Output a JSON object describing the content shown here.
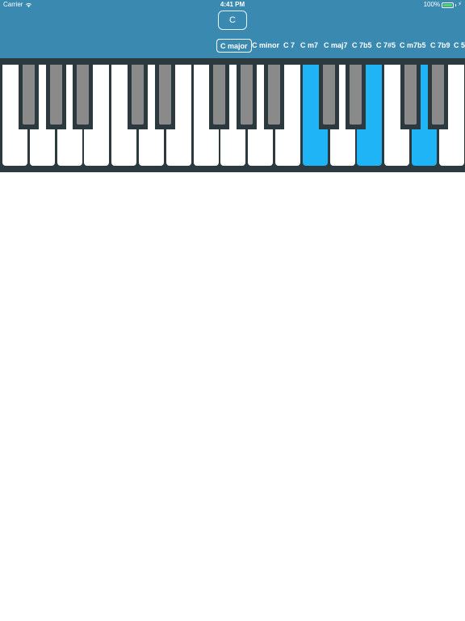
{
  "status_bar": {
    "carrier": "Carrier",
    "time": "4:41 PM",
    "battery": "100%",
    "icons": [
      "wifi-icon",
      "battery-icon",
      "charging-bolt-icon"
    ]
  },
  "key_selector": {
    "label": "C"
  },
  "chords": [
    {
      "label": "C major",
      "selected": true
    },
    {
      "label": "C minor",
      "selected": false
    },
    {
      "label": "C 7",
      "selected": false
    },
    {
      "label": "C m7",
      "selected": false
    },
    {
      "label": "C maj7",
      "selected": false
    },
    {
      "label": "C 7b5",
      "selected": false
    },
    {
      "label": "C 7#5",
      "selected": false
    },
    {
      "label": "C m7b5",
      "selected": false
    },
    {
      "label": "C 7b9",
      "selected": false
    },
    {
      "label": "C 5",
      "selected": false
    }
  ],
  "keyboard": {
    "white_key_count": 17,
    "white_notes": [
      "F",
      "G",
      "A",
      "B",
      "C",
      "D",
      "E",
      "F",
      "G",
      "A",
      "B",
      "C",
      "D",
      "E",
      "F",
      "G",
      "A"
    ],
    "highlighted_notes": [
      "C",
      "E",
      "G"
    ],
    "highlight_color": "#1eb4f5",
    "header_color": "#3a89b0",
    "frame_color": "#2c3a40",
    "black_key_color": "#8a8a8a"
  }
}
